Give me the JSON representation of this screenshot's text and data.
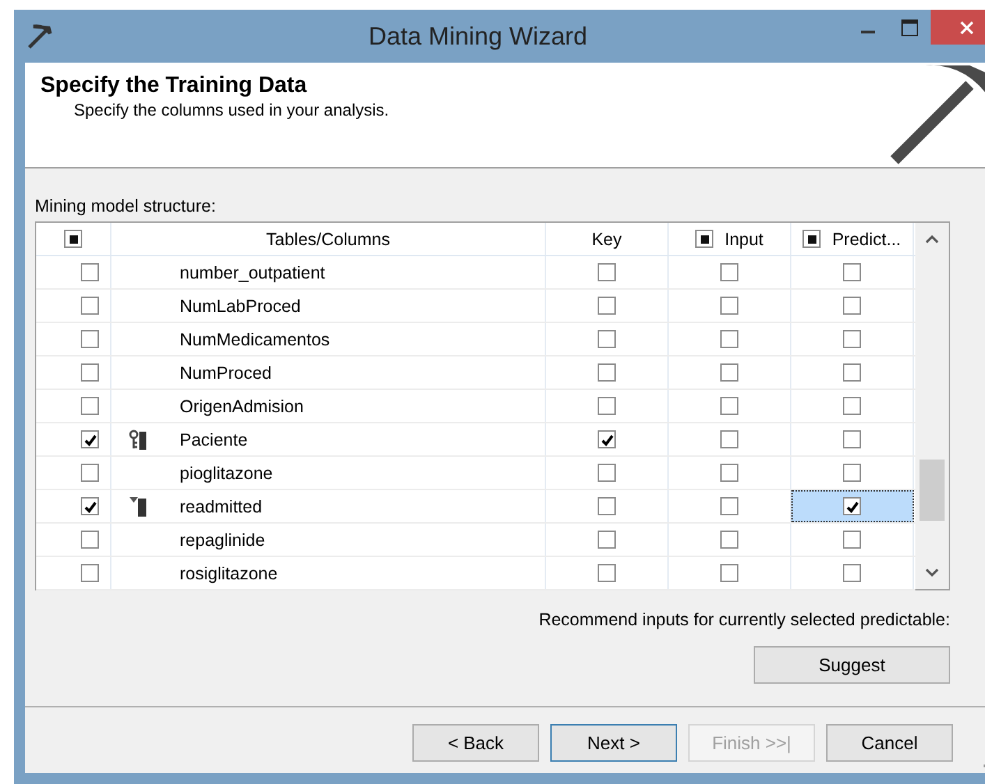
{
  "window": {
    "title": "Data Mining Wizard"
  },
  "header": {
    "title": "Specify the Training Data",
    "subtitle": "Specify the columns used in your analysis."
  },
  "grid_label": "Mining model structure:",
  "columns": [
    {
      "label": "Tables/Columns"
    },
    {
      "label": "Key"
    },
    {
      "label": "Input",
      "mixed": true
    },
    {
      "label": "Predict...",
      "mixed": true
    }
  ],
  "select_all_mixed": true,
  "rows": [
    {
      "name": "number_outpatient",
      "kind": "plain",
      "checked": false,
      "key": false,
      "input": false,
      "predict": false,
      "selected": false
    },
    {
      "name": "NumLabProced",
      "kind": "plain",
      "checked": false,
      "key": false,
      "input": false,
      "predict": false,
      "selected": false
    },
    {
      "name": "NumMedicamentos",
      "kind": "plain",
      "checked": false,
      "key": false,
      "input": false,
      "predict": false,
      "selected": false
    },
    {
      "name": "NumProced",
      "kind": "plain",
      "checked": false,
      "key": false,
      "input": false,
      "predict": false,
      "selected": false
    },
    {
      "name": "OrigenAdmision",
      "kind": "plain",
      "checked": false,
      "key": false,
      "input": false,
      "predict": false,
      "selected": false
    },
    {
      "name": "Paciente",
      "kind": "key",
      "checked": true,
      "key": true,
      "input": false,
      "predict": false,
      "selected": false
    },
    {
      "name": "pioglitazone",
      "kind": "plain",
      "checked": false,
      "key": false,
      "input": false,
      "predict": false,
      "selected": false
    },
    {
      "name": "readmitted",
      "kind": "predictable",
      "checked": true,
      "key": false,
      "input": false,
      "predict": true,
      "selected": true
    },
    {
      "name": "repaglinide",
      "kind": "plain",
      "checked": false,
      "key": false,
      "input": false,
      "predict": false,
      "selected": false
    },
    {
      "name": "rosiglitazone",
      "kind": "plain",
      "checked": false,
      "key": false,
      "input": false,
      "predict": false,
      "selected": false
    }
  ],
  "recommend_label": "Recommend inputs for currently selected predictable:",
  "suggest_button": "Suggest",
  "buttons": [
    {
      "label": "< Back",
      "default": false,
      "disabled": false
    },
    {
      "label": "Next >",
      "default": true,
      "disabled": false
    },
    {
      "label": "Finish >>|",
      "default": false,
      "disabled": true
    },
    {
      "label": "Cancel",
      "default": false,
      "disabled": false
    }
  ]
}
